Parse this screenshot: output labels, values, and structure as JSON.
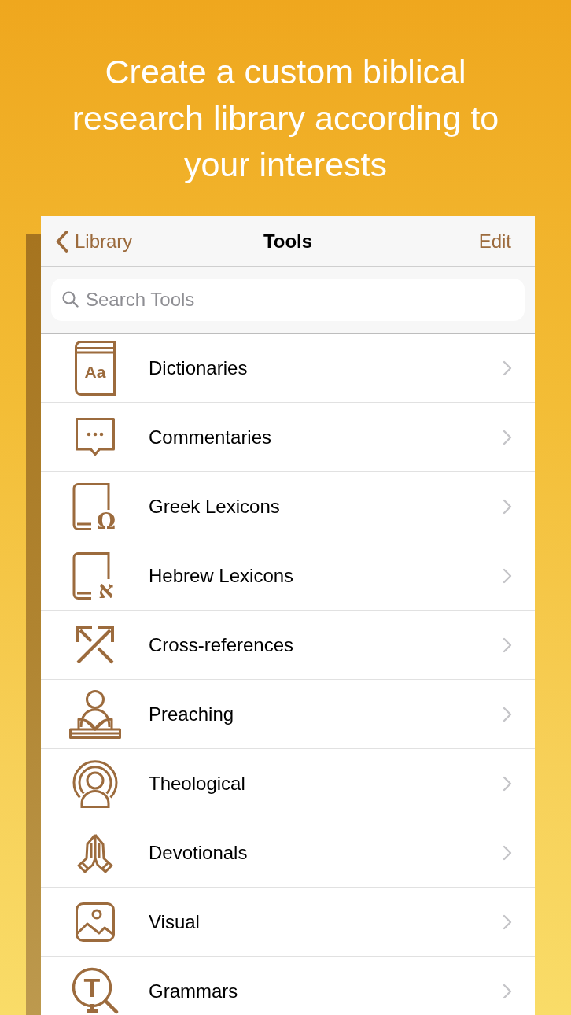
{
  "headline": "Create a custom biblical research library according to your interests",
  "nav_bar": {
    "back": "Library",
    "title": "Tools",
    "action": "Edit"
  },
  "search": {
    "placeholder": "Search Tools"
  },
  "items": [
    {
      "label": "Dictionaries",
      "glyph": "Aa"
    },
    {
      "label": "Commentaries"
    },
    {
      "label": "Greek Lexicons",
      "glyph": "Ω"
    },
    {
      "label": "Hebrew Lexicons",
      "glyph": "א"
    },
    {
      "label": "Cross-references"
    },
    {
      "label": "Preaching"
    },
    {
      "label": "Theological"
    },
    {
      "label": "Devotionals"
    },
    {
      "label": "Visual"
    },
    {
      "label": "Grammars",
      "glyph": "T"
    }
  ]
}
